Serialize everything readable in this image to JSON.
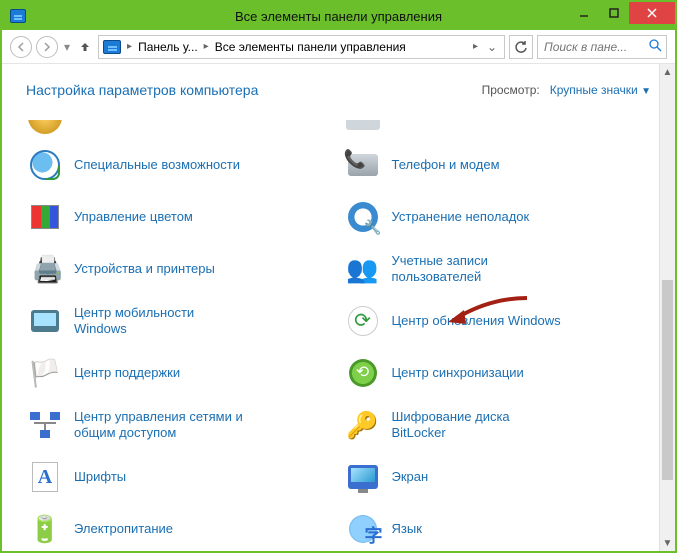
{
  "window": {
    "title": "Все элементы панели управления"
  },
  "nav": {
    "breadcrumb_root": "Панель у...",
    "breadcrumb_current": "Все элементы панели управления",
    "search_placeholder": "Поиск в пане..."
  },
  "page": {
    "heading": "Настройка параметров компьютера",
    "view_label": "Просмотр:",
    "view_value": "Крупные значки"
  },
  "items": {
    "left": [
      {
        "id": "ease-of-access",
        "label": "Специальные возможности",
        "iconClass": "ic-access",
        "iconName": "ease-of-access-icon"
      },
      {
        "id": "color-management",
        "label": "Управление цветом",
        "iconClass": "ic-color",
        "iconName": "color-management-icon"
      },
      {
        "id": "devices-printers",
        "label": "Устройства и принтеры",
        "iconClass": "ic-devprint",
        "iconName": "devices-printers-icon",
        "glyph": "🖨️"
      },
      {
        "id": "mobility-center",
        "label": "Центр мобильности Windows",
        "iconClass": "ic-mobility",
        "iconName": "mobility-center-icon"
      },
      {
        "id": "action-center",
        "label": "Центр поддержки",
        "iconClass": "ic-support",
        "iconName": "action-center-icon",
        "glyph": "🏳️"
      },
      {
        "id": "network-sharing",
        "label": "Центр управления сетями и общим доступом",
        "iconClass": "ic-network",
        "iconName": "network-sharing-icon"
      },
      {
        "id": "fonts",
        "label": "Шрифты",
        "iconClass": "ic-fonts",
        "iconName": "fonts-icon",
        "glyph": "A"
      },
      {
        "id": "power-options",
        "label": "Электропитание",
        "iconClass": "ic-power",
        "iconName": "power-options-icon",
        "glyph": "🔋"
      }
    ],
    "right": [
      {
        "id": "phone-modem",
        "label": "Телефон и модем",
        "iconClass": "ic-phone",
        "iconName": "phone-modem-icon"
      },
      {
        "id": "troubleshooting",
        "label": "Устранение неполадок",
        "iconClass": "ic-trouble",
        "iconName": "troubleshooting-icon"
      },
      {
        "id": "user-accounts",
        "label": "Учетные записи пользователей",
        "iconClass": "ic-users",
        "iconName": "user-accounts-icon",
        "glyph": "👥"
      },
      {
        "id": "windows-update",
        "label": "Центр обновления Windows",
        "iconClass": "ic-update",
        "iconName": "windows-update-icon",
        "glyph": "⟳",
        "highlight": true
      },
      {
        "id": "sync-center",
        "label": "Центр синхронизации",
        "iconClass": "ic-sync",
        "iconName": "sync-center-icon",
        "glyph": "⟲"
      },
      {
        "id": "bitlocker",
        "label": "Шифрование диска BitLocker",
        "iconClass": "ic-bitlocker",
        "iconName": "bitlocker-icon",
        "glyph": "🔑"
      },
      {
        "id": "display",
        "label": "Экран",
        "iconClass": "ic-display",
        "iconName": "display-icon"
      },
      {
        "id": "language",
        "label": "Язык",
        "iconClass": "ic-lang",
        "iconName": "language-icon"
      }
    ]
  },
  "annotation": {
    "target": "windows-update",
    "color": "#a32014"
  }
}
